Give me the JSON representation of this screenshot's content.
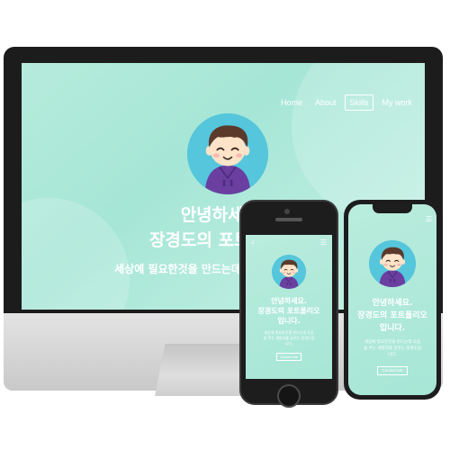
{
  "desktop": {
    "nav": [
      "Home",
      "About",
      "Skills",
      "My work"
    ],
    "active_nav": "Skills",
    "hero_title_line1": "안녕하세요.",
    "hero_title_line2": "장경도의 포트폴리오",
    "hero_subtitle": "세상에 필요한것을 만드는데 도움을 주는 개발자"
  },
  "mobile": {
    "logo": "J",
    "menu_icon": "☰",
    "title_line1": "안녕하세요.",
    "title_line2": "장경도의 포트폴리오",
    "title_line3": "입니다.",
    "desc_line1": "세상에 필요한것을 만드는데 도움",
    "desc_line2": "을 주는 개발자를 꿈꾸는 장경도입",
    "desc_line3": "니다.",
    "button": "Contact Me"
  },
  "icons": {
    "apple": "apple-logo-icon",
    "hamburger": "hamburger-menu-icon",
    "avatar": "avatar-character-icon"
  },
  "colors": {
    "accent_mint": "#a6e6d6",
    "avatar_bg": "#55c6db",
    "hoodie": "#6a3fa0",
    "hair": "#5b3a2c"
  }
}
